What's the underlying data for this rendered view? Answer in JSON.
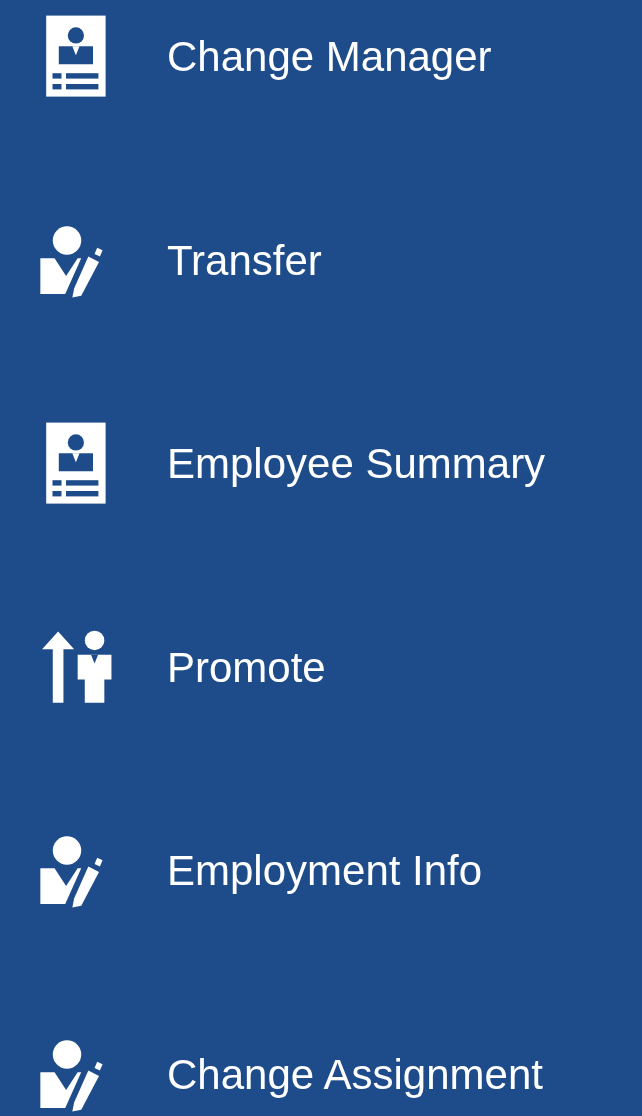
{
  "menu": [
    {
      "label": "Change Manager",
      "kind": "badge"
    },
    {
      "label": "Transfer",
      "kind": "edit"
    },
    {
      "label": "Employee Summary",
      "kind": "badge"
    },
    {
      "label": "Promote",
      "kind": "promote"
    },
    {
      "label": "Employment Info",
      "kind": "edit"
    },
    {
      "label": "Change Assignment",
      "kind": "edit"
    }
  ]
}
